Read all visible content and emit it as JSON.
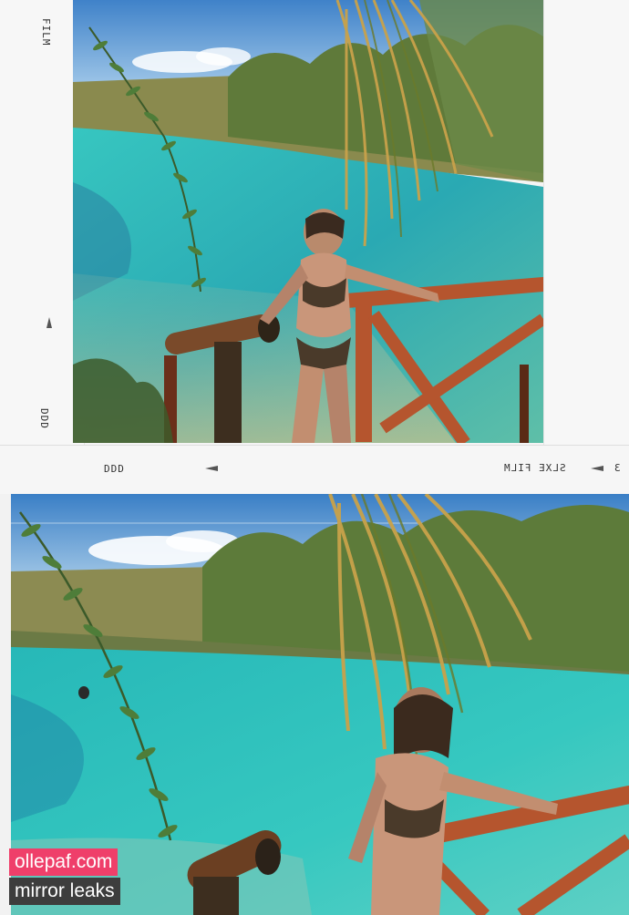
{
  "film_edge": {
    "upper_frame_brand": "FILM",
    "upper_frame_code": "DDD",
    "middle_strip_code": "DDD",
    "middle_strip_brand": "SLXE FILM",
    "middle_strip_number": "3"
  },
  "watermark": {
    "line1": "ollepaf.com",
    "line2": "mirror leaks"
  },
  "colors": {
    "watermark_pink": "#ef3f6a",
    "watermark_dark": "#3d3d3d",
    "water": "#2fbfb8",
    "railing": "#b5552e"
  }
}
